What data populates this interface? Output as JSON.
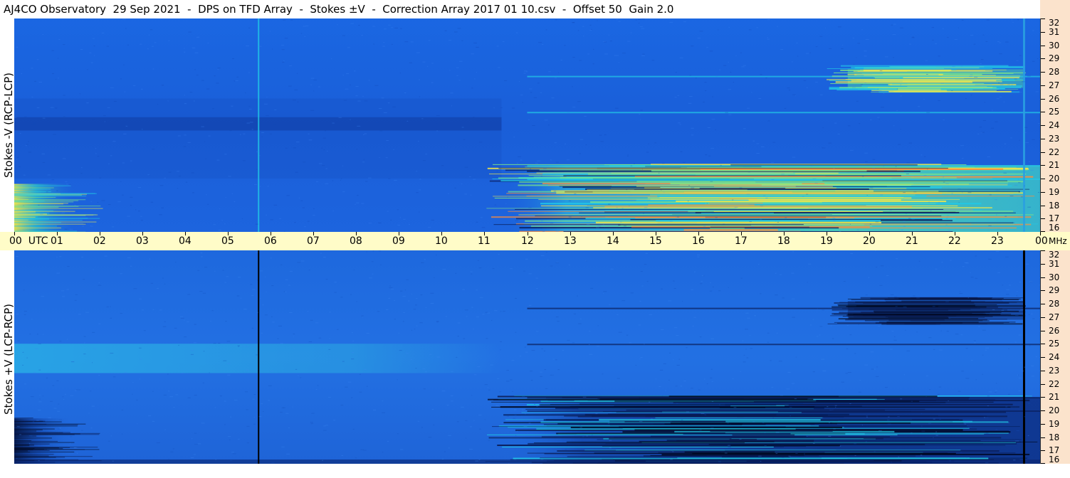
{
  "header": {
    "title": "AJ4CO Observatory  29 Sep 2021  -  DPS on TFD Array  -  Stokes ±V  -  Correction Array 2017 01 10.csv  -  Offset 50  Gain 2.0"
  },
  "panels": {
    "top_label": "Stokes -V (RCP-LCP)",
    "bottom_label": "Stokes +V (LCP-RCP)"
  },
  "time_axis": {
    "labels": [
      "00  UTC",
      "01",
      "02",
      "03",
      "04",
      "05",
      "06",
      "07",
      "08",
      "09",
      "10",
      "11",
      "12",
      "13",
      "14",
      "15",
      "16",
      "17",
      "18",
      "19",
      "20",
      "21",
      "22",
      "23",
      "00"
    ],
    "unit": "MHz"
  },
  "freq_axis": {
    "labels": [
      "32",
      "31",
      "30",
      "29",
      "28",
      "27",
      "26",
      "25",
      "24",
      "23",
      "22",
      "21",
      "20",
      "19",
      "18",
      "17",
      "16"
    ]
  },
  "colors": {
    "background_blue": "#1a5fd9",
    "deep_blue": "#0b2f8f",
    "cyan": "#22c9e6",
    "green": "#7be38a",
    "yellow": "#f0e64a",
    "axis_bg_time": "#fffcc8",
    "axis_bg_freq": "#fbe3cc"
  },
  "chart_data": [
    {
      "type": "heatmap",
      "title": "Stokes -V (RCP-LCP)",
      "xlabel": "UTC",
      "ylabel": "MHz",
      "xlim": [
        0,
        24
      ],
      "ylim": [
        16,
        32
      ],
      "xticks": [
        "00",
        "01",
        "02",
        "03",
        "04",
        "05",
        "06",
        "07",
        "08",
        "09",
        "10",
        "11",
        "12",
        "13",
        "14",
        "15",
        "16",
        "17",
        "18",
        "19",
        "20",
        "21",
        "22",
        "23",
        "00"
      ],
      "yticks": [
        16,
        17,
        18,
        19,
        20,
        21,
        22,
        23,
        24,
        25,
        26,
        27,
        28,
        29,
        30,
        31,
        32
      ],
      "colormap": "blue-cyan-green-yellow",
      "notable_features": {
        "vertical_line_utc": 5.7,
        "vertical_line_right_utc": 23.6,
        "dark_band_mhz": [
          23.6,
          24.6
        ],
        "dark_band_utc": [
          0,
          11.4
        ],
        "enhanced_activity_utc": [
          11.4,
          24
        ],
        "enhanced_activity_mhz": [
          16,
          21
        ]
      }
    },
    {
      "type": "heatmap",
      "title": "Stokes +V (LCP-RCP)",
      "xlabel": "UTC",
      "ylabel": "MHz",
      "xlim": [
        0,
        24
      ],
      "ylim": [
        16,
        32
      ],
      "xticks": [
        "00",
        "01",
        "02",
        "03",
        "04",
        "05",
        "06",
        "07",
        "08",
        "09",
        "10",
        "11",
        "12",
        "13",
        "14",
        "15",
        "16",
        "17",
        "18",
        "19",
        "20",
        "21",
        "22",
        "23",
        "00"
      ],
      "yticks": [
        16,
        17,
        18,
        19,
        20,
        21,
        22,
        23,
        24,
        25,
        26,
        27,
        28,
        29,
        30,
        31,
        32
      ],
      "colormap": "blue-cyan-green-yellow",
      "notable_features": {
        "vertical_line_utc": 5.7,
        "vertical_line_right_utc": 23.6,
        "light_band_mhz": [
          23.6,
          24.6
        ],
        "light_band_utc": [
          0,
          11.4
        ],
        "dark_activity_utc": [
          11.4,
          24
        ],
        "dark_activity_mhz": [
          16,
          21
        ]
      }
    }
  ]
}
